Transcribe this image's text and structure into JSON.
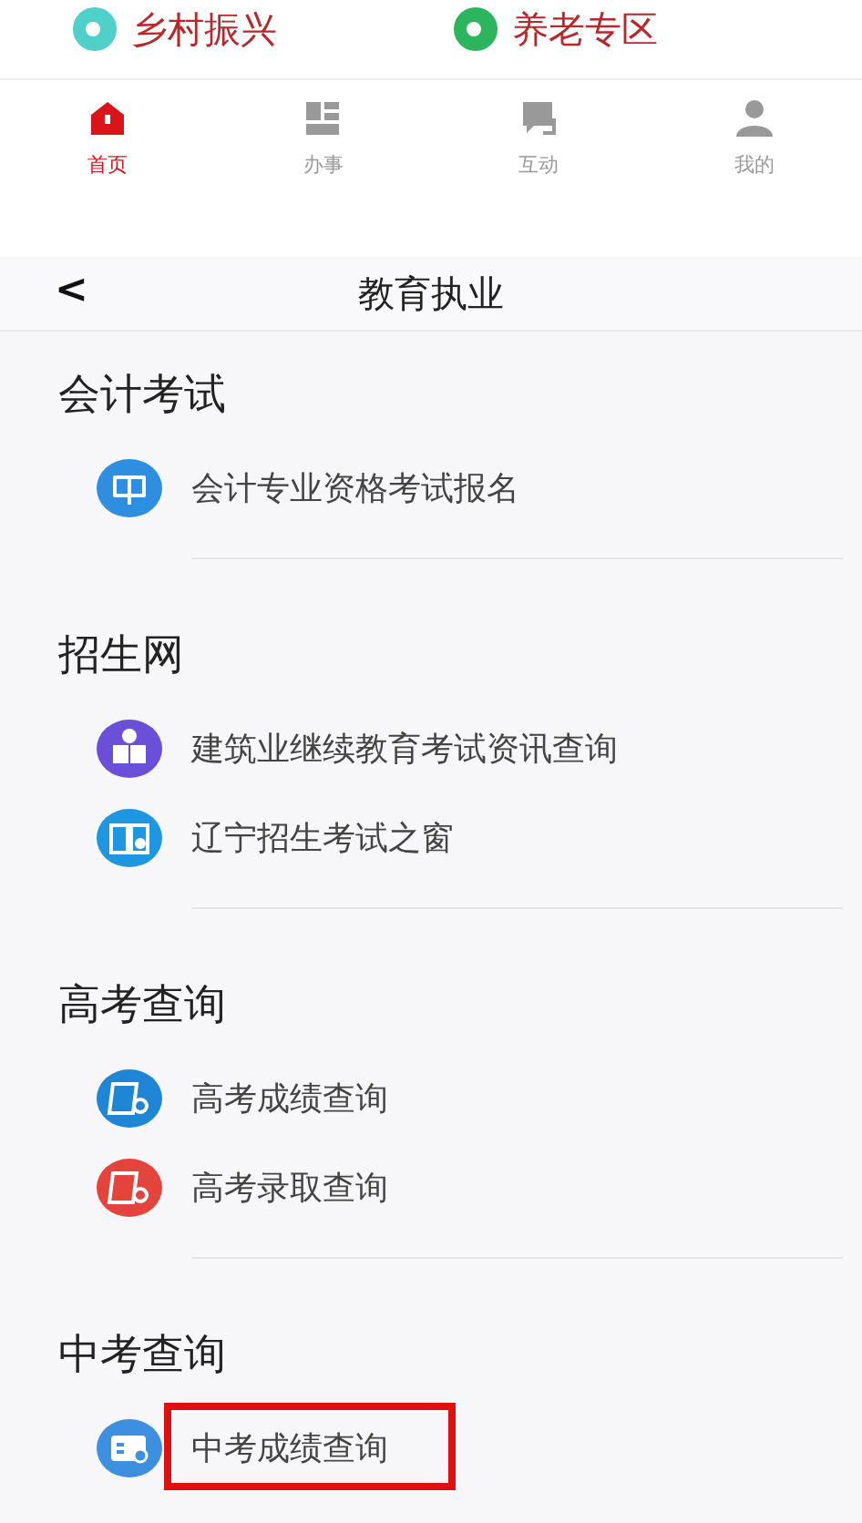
{
  "top_links": [
    {
      "label": "乡村振兴",
      "color": "#4fd0c9"
    },
    {
      "label": "养老专区",
      "color": "#2db55d"
    }
  ],
  "tab_bar": [
    {
      "label": "首页",
      "kind": "home",
      "selected": true
    },
    {
      "label": "办事",
      "kind": "grid",
      "selected": false
    },
    {
      "label": "互动",
      "kind": "chat",
      "selected": false
    },
    {
      "label": "我的",
      "kind": "person",
      "selected": false
    }
  ],
  "header": {
    "back": "<",
    "title": "教育执业"
  },
  "sections": [
    {
      "title": "会计考试",
      "items": [
        {
          "label": "会计专业资格考试报名",
          "kind": "screen",
          "color": "#2e8ee0",
          "highlighted": false
        }
      ]
    },
    {
      "title": "招生网",
      "items": [
        {
          "label": "建筑业继续教育考试资讯查询",
          "kind": "reader",
          "color": "#6a4fd8",
          "highlighted": false
        },
        {
          "label": "辽宁招生考试之窗",
          "kind": "book",
          "color": "#1e97e0",
          "highlighted": false
        }
      ]
    },
    {
      "title": "高考查询",
      "items": [
        {
          "label": "高考成绩查询",
          "kind": "scroll",
          "color": "#1f86d6",
          "highlighted": false
        },
        {
          "label": "高考录取查询",
          "kind": "scroll",
          "color": "#e4443c",
          "highlighted": false
        }
      ]
    },
    {
      "title": "中考查询",
      "items": [
        {
          "label": "中考成绩查询",
          "kind": "card",
          "color": "#3d8fe0",
          "highlighted": true
        }
      ]
    }
  ]
}
